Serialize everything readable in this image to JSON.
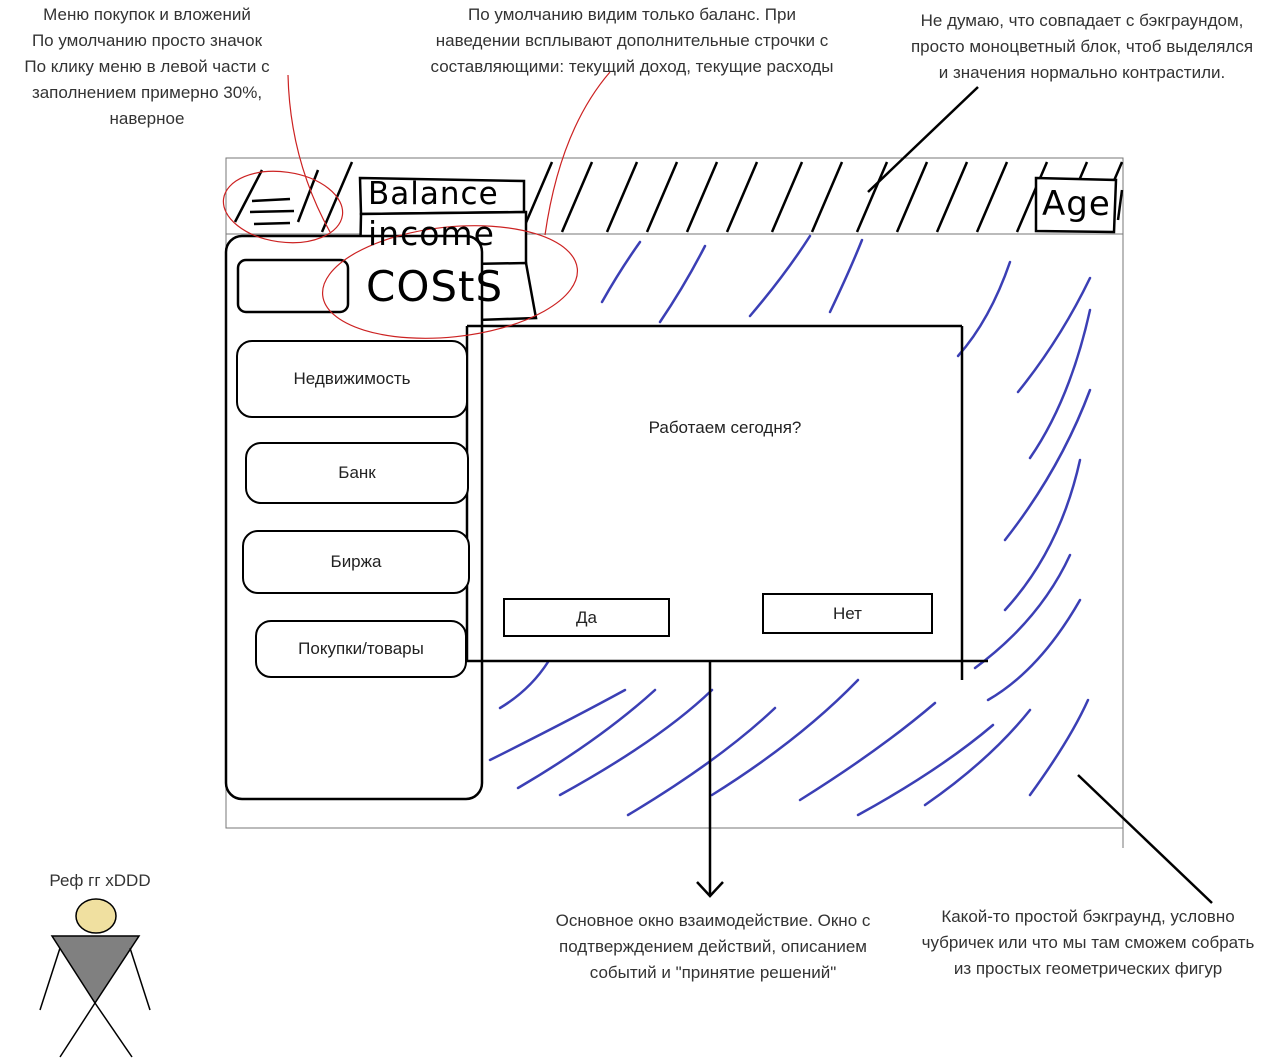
{
  "notes": {
    "menu_note": [
      "Меню покупок и вложений",
      "По умолчанию просто значок",
      "По клику меню в левой части с",
      "заполнением примерно 30%,",
      "наверное"
    ],
    "balance_note": [
      "По умолчанию видим только баланс. При",
      "наведении всплывают дополнительные строчки с",
      "составляющими: текущий доход, текущие расходы"
    ],
    "header_note": [
      "Не думаю, что совпадает с бэкграундом,",
      "просто моноцветный блок, чтоб выделялся",
      "и значения нормально контрастили."
    ],
    "dialog_note": [
      "Основное окно взаимодействие. Окно с",
      "подтверждением действий, описанием",
      "событий и \"принятие решений\""
    ],
    "background_note": [
      "Какой-то простой бэкграунд, условно",
      "чубричек или что мы там сможем собрать",
      "из простых геометрических фигур"
    ],
    "ref_note": "Реф гг xDDD"
  },
  "header": {
    "balance_label": "Balance",
    "income_label": "income",
    "costs_label": "COStS",
    "age_label": "Age"
  },
  "side_menu": {
    "items": [
      "Недвижимость",
      "Банк",
      "Биржа",
      "Покупки/товары"
    ]
  },
  "dialog": {
    "question": "Работаем сегодня?",
    "yes_label": "Да",
    "no_label": "Нет"
  },
  "colors": {
    "sketch_line": "#000000",
    "annotation_red": "#cc2222",
    "background_strokes": "#3b3fb5",
    "ref_head": "#f0e0a0",
    "ref_body": "#808080"
  }
}
